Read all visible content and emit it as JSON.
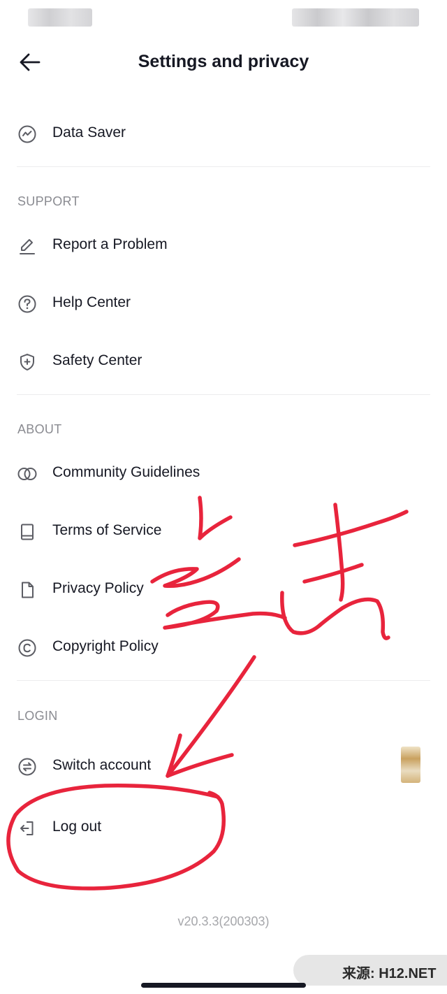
{
  "header": {
    "title": "Settings and privacy"
  },
  "rows": {
    "data_saver": "Data Saver",
    "report_problem": "Report a Problem",
    "help_center": "Help Center",
    "safety_center": "Safety Center",
    "community_guidelines": "Community Guidelines",
    "terms_of_service": "Terms of Service",
    "privacy_policy": "Privacy Policy",
    "copyright_policy": "Copyright Policy",
    "switch_account": "Switch account",
    "log_out": "Log out"
  },
  "sections": {
    "support": "SUPPORT",
    "about": "ABOUT",
    "login": "LOGIN"
  },
  "version": "v20.3.3(200303)",
  "watermark": "来源: H12.NET",
  "icons": {
    "back": "arrow-left-icon",
    "data_saver": "data-saver-icon",
    "report": "pencil-icon",
    "help": "question-circle-icon",
    "safety": "shield-plus-icon",
    "community": "overlapping-circles-icon",
    "terms": "book-icon",
    "privacy": "document-icon",
    "copyright": "copyright-icon",
    "switch": "switch-arrows-icon",
    "logout": "logout-icon"
  },
  "colors": {
    "text": "#161823",
    "secondary": "#8a8b91",
    "divider": "#ececee",
    "annotation": "#e8243c"
  }
}
